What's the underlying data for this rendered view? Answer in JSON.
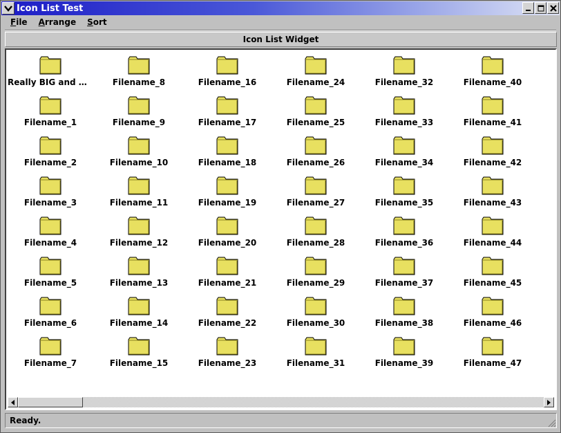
{
  "window": {
    "title": "Icon List Test"
  },
  "menubar": {
    "items": [
      {
        "key": "F",
        "rest": "ile"
      },
      {
        "key": "A",
        "rest": "rrange"
      },
      {
        "key": "S",
        "rest": "ort"
      }
    ]
  },
  "header": {
    "label": "Icon List Widget"
  },
  "icons": {
    "icon_type": "folder-icon",
    "folder_color": "#e8e060",
    "columns": [
      [
        "Really BIG and wi...",
        "Filename_1",
        "Filename_2",
        "Filename_3",
        "Filename_4",
        "Filename_5",
        "Filename_6",
        "Filename_7"
      ],
      [
        "Filename_8",
        "Filename_9",
        "Filename_10",
        "Filename_11",
        "Filename_12",
        "Filename_13",
        "Filename_14",
        "Filename_15"
      ],
      [
        "Filename_16",
        "Filename_17",
        "Filename_18",
        "Filename_19",
        "Filename_20",
        "Filename_21",
        "Filename_22",
        "Filename_23"
      ],
      [
        "Filename_24",
        "Filename_25",
        "Filename_26",
        "Filename_27",
        "Filename_28",
        "Filename_29",
        "Filename_30",
        "Filename_31"
      ],
      [
        "Filename_32",
        "Filename_33",
        "Filename_34",
        "Filename_35",
        "Filename_36",
        "Filename_37",
        "Filename_38",
        "Filename_39"
      ],
      [
        "Filename_40",
        "Filename_41",
        "Filename_42",
        "Filename_43",
        "Filename_44",
        "Filename_45",
        "Filename_46",
        "Filename_47"
      ]
    ]
  },
  "statusbar": {
    "text": "Ready."
  },
  "colors": {
    "titlebar_start": "#1c1cc6",
    "folder_fill": "#e8e060"
  }
}
